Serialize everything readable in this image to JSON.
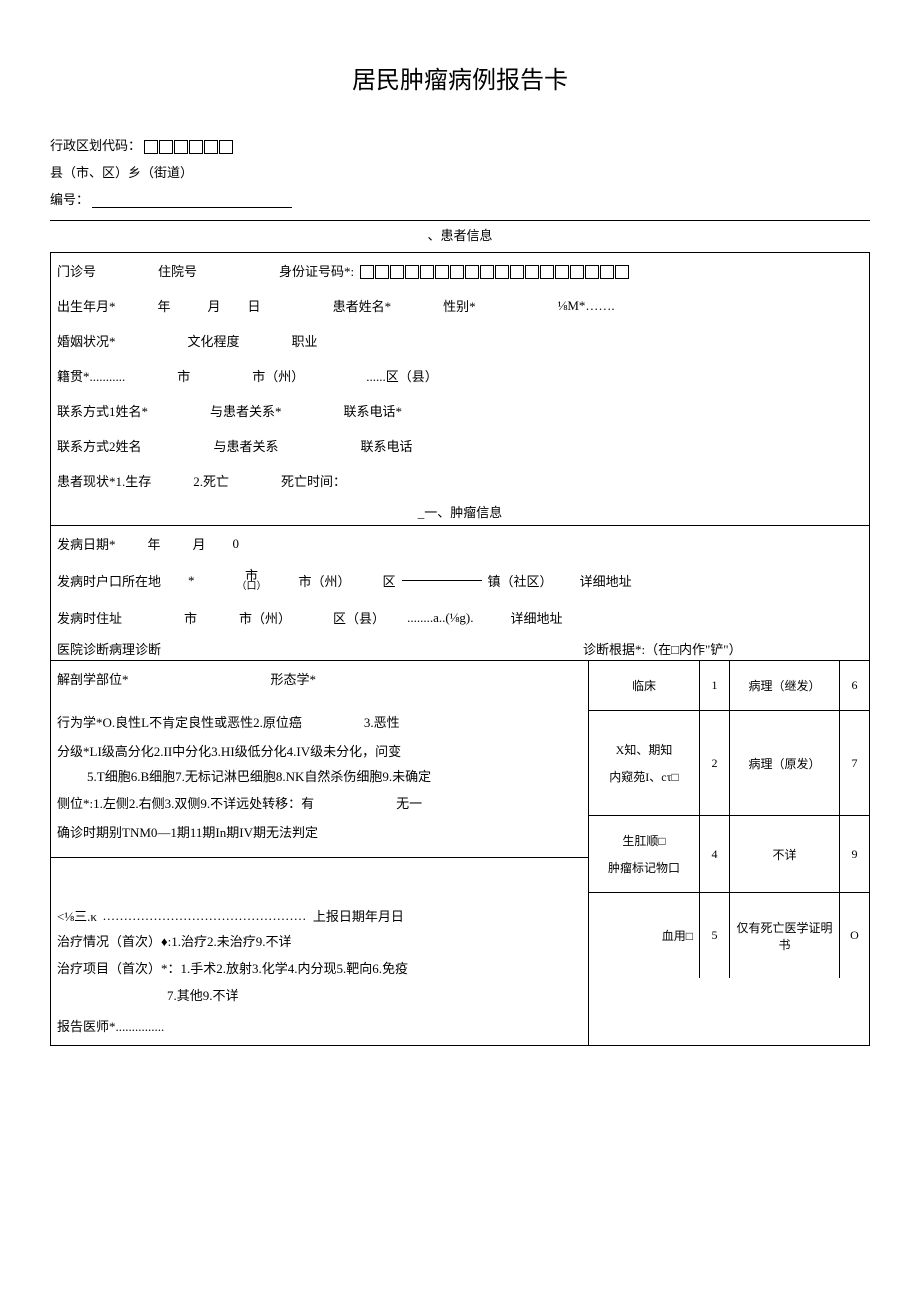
{
  "title": "居民肿瘤病例报告卡",
  "header": {
    "admin_code_label": "行政区划代码：",
    "county_label": "县（市、区）乡（街道）",
    "serial_label": "编号："
  },
  "section1": {
    "title": "、患者信息",
    "outpatient": "门诊号",
    "inpatient": "住院号",
    "id_label": "身份证号码*:",
    "dob": "出生年月*",
    "year": "年",
    "month": "月",
    "day": "日",
    "name": "患者姓名*",
    "gender": "性别*",
    "ethnic": "⅛M*…….",
    "marital": "婚姻状况*",
    "edu": "文化程度",
    "occupation": "职业",
    "native": "籍贯*...........",
    "city": "市",
    "prefecture": "市（州）",
    "district": "......区（县）",
    "contact1_name": "联系方式1姓名*",
    "contact1_rel": "与患者关系*",
    "contact1_phone": "联系电话*",
    "contact2_name": "联系方式2姓名",
    "contact2_rel": "与患者关系",
    "contact2_phone": "联系电话",
    "status": "患者现状*1.生存",
    "status2": "2.死亡",
    "death_time": "死亡时间："
  },
  "section2": {
    "title": "_一、肿瘤信息",
    "onset": "发病日期*",
    "onset_year": "年",
    "onset_month": "月",
    "onset_day": "0",
    "hukou": "发病时户口所在地",
    "star": "*",
    "city": "市",
    "small": "（口）",
    "prefecture": "市（州）",
    "district": "区",
    "town": "镇（社区）",
    "detail": "详细地址",
    "addr": "发病时住址",
    "district2": "区（县）",
    "detail_mid": "........a..(⅛g)."
  },
  "diag": {
    "header": "医院诊断病理诊断",
    "basis_header": "诊断根据*:（在□内作\"铲\"）",
    "anatomy": "解剖学部位*",
    "morphology": "形态学*",
    "behavior": "行为学*O.良性L不肯定良性或恶性2.原位癌",
    "behavior3": "3.恶性",
    "grade": "分级*LI级高分化2.II中分化3.HI级低分化4.IV级未分化，问变",
    "grade2": "5.T细胞6.B细胞7.无标记淋巴细胞8.NK自然杀伤细胞9.未确定",
    "side": "侧位*:1.左侧2.右侧3.双侧9.不详远处转移：有",
    "side_none": "无一",
    "stage": "确诊时期别TNM0—1期11期In期IV期无法判定",
    "bottom_pre": "<⅛三.κ",
    "bottom_dots": "................................................",
    "report_date": "上报日期年月日",
    "treat_status": "治疗情况（首次）♦:1.治疗2.未治疗9.不详",
    "treat_items": "治疗项目（首次）*：1.手术2.放射3.化学4.内分现5.靶向6.免疫",
    "treat_items2": "7.其他9.不详",
    "reporter": "报告医师*...............",
    "basis": {
      "r1c1": "临床",
      "r1c2": "1",
      "r1c3": "病理（继发）",
      "r1c4": "6",
      "r2c1a": "X知、期知",
      "r2c1b": "内窥苑I、cτ□",
      "r2c2": "2",
      "r2c3": "病理（原发）",
      "r2c4": "7",
      "r3c1a": "生肛顺□",
      "r3c1b": "肿瘤标记物口",
      "r3c2": "4",
      "r3c3": "不详",
      "r3c4": "9",
      "r4c1": "血用□",
      "r4c2": "5",
      "r4c3": "仅有死亡医学证明书",
      "r4c4": "O"
    }
  }
}
